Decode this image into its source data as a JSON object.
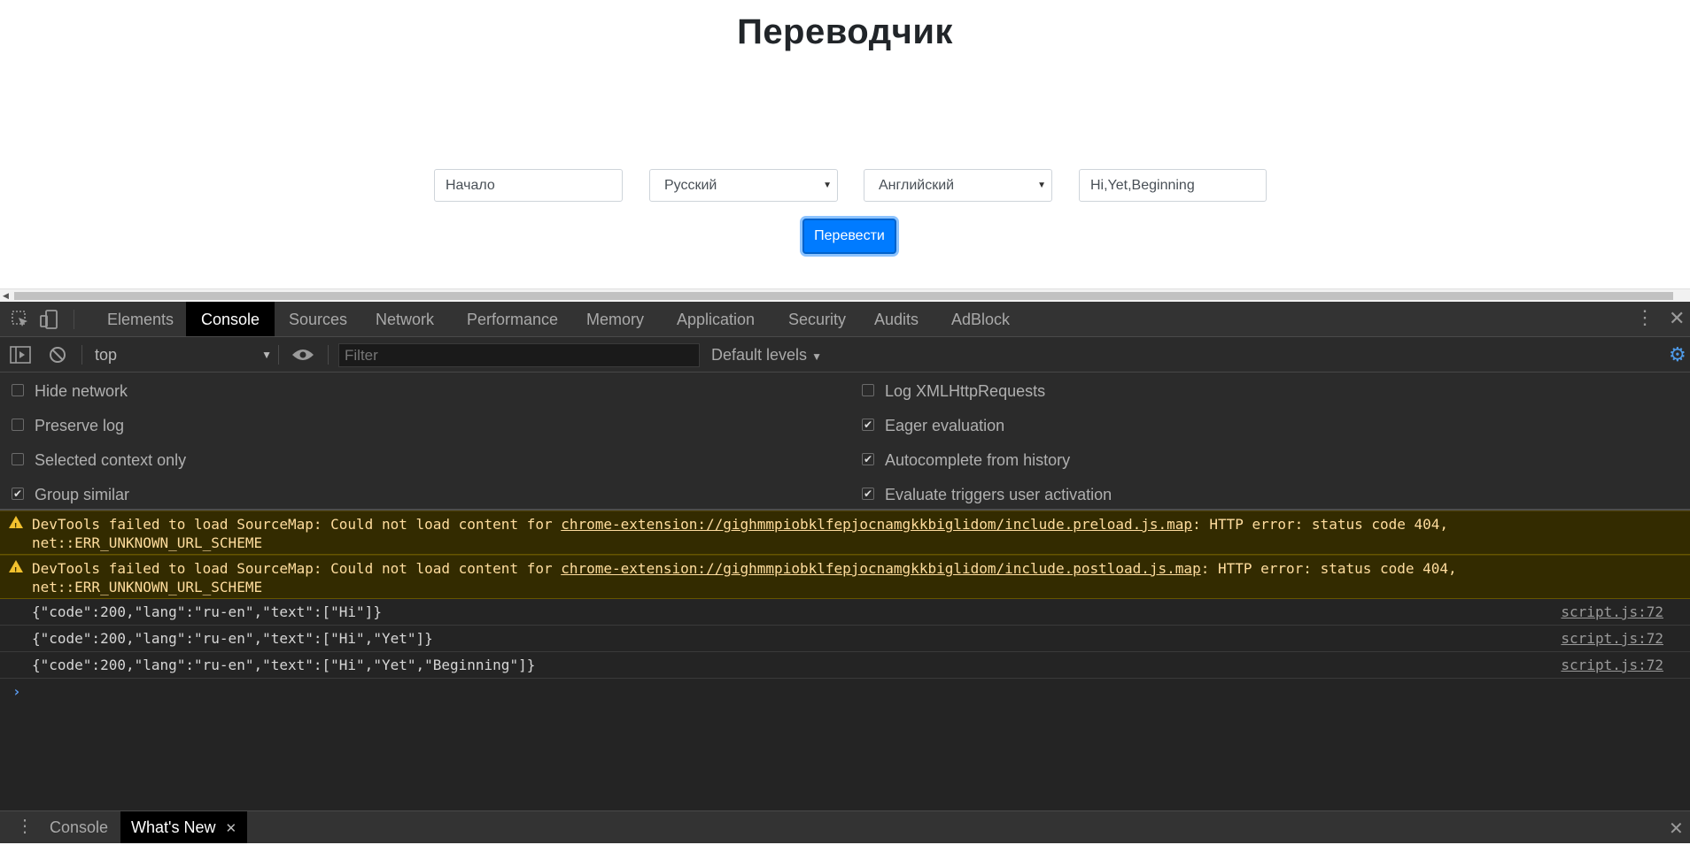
{
  "page": {
    "title": "Переводчик",
    "text_input_value": "Начало",
    "source_lang": "Русский",
    "target_lang": "Английский",
    "result_value": "Hi,Yet,Beginning",
    "translate_label": "Перевести"
  },
  "devtools": {
    "tabs": [
      "Elements",
      "Console",
      "Sources",
      "Network",
      "Performance",
      "Memory",
      "Application",
      "Security",
      "Audits",
      "AdBlock"
    ],
    "active_tab": "Console",
    "toolbar": {
      "context": "top",
      "filter_placeholder": "Filter",
      "levels": "Default levels"
    },
    "settings_left": [
      {
        "label": "Hide network",
        "checked": false
      },
      {
        "label": "Preserve log",
        "checked": false
      },
      {
        "label": "Selected context only",
        "checked": false
      },
      {
        "label": "Group similar",
        "checked": true
      }
    ],
    "settings_right": [
      {
        "label": "Log XMLHttpRequests",
        "checked": false
      },
      {
        "label": "Eager evaluation",
        "checked": true
      },
      {
        "label": "Autocomplete from history",
        "checked": true
      },
      {
        "label": "Evaluate triggers user activation",
        "checked": true
      }
    ],
    "warnings": [
      {
        "prefix": "DevTools failed to load SourceMap: Could not load content for ",
        "link": "chrome-extension://gighmmpiobklfepjocnamgkkbiglidom/include.preload.js.map",
        "suffix": ": HTTP error: status code 404,",
        "line2": "net::ERR_UNKNOWN_URL_SCHEME"
      },
      {
        "prefix": "DevTools failed to load SourceMap: Could not load content for ",
        "link": "chrome-extension://gighmmpiobklfepjocnamgkkbiglidom/include.postload.js.map",
        "suffix": ": HTTP error: status code 404,",
        "line2": "net::ERR_UNKNOWN_URL_SCHEME"
      }
    ],
    "logs": [
      {
        "text": "{\"code\":200,\"lang\":\"ru-en\",\"text\":[\"Hi\"]}",
        "source": "script.js:72"
      },
      {
        "text": "{\"code\":200,\"lang\":\"ru-en\",\"text\":[\"Hi\",\"Yet\"]}",
        "source": "script.js:72"
      },
      {
        "text": "{\"code\":200,\"lang\":\"ru-en\",\"text\":[\"Hi\",\"Yet\",\"Beginning\"]}",
        "source": "script.js:72"
      }
    ],
    "drawer_tabs": {
      "console": "Console",
      "whats_new": "What's New"
    },
    "colors": {
      "active_tab_bg": "#000000",
      "warning_bg": "#332b00",
      "warning_text": "#ffdd9e",
      "button_blue": "#007bff"
    }
  }
}
